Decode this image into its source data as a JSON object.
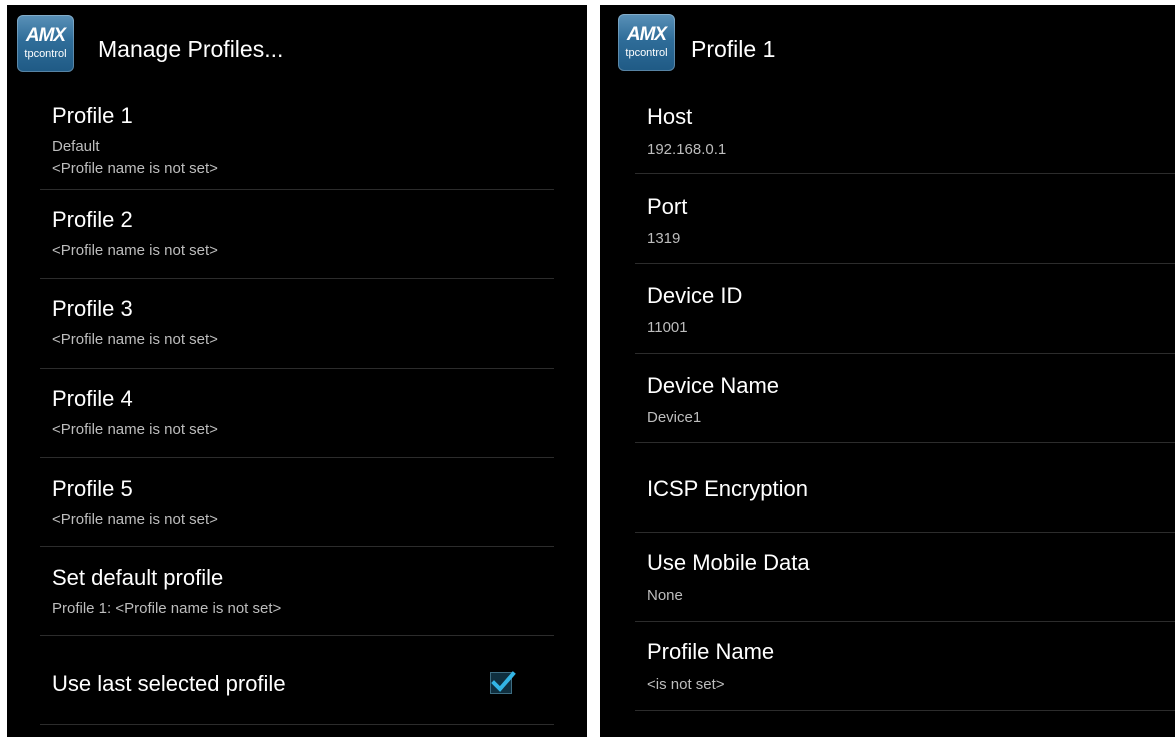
{
  "left_screen": {
    "header": {
      "app_icon": "amx-tpcontrol-icon",
      "icon_brand": "AMX",
      "icon_subtitle": "tpcontrol",
      "title": "Manage Profiles..."
    },
    "items": [
      {
        "title": "Profile 1",
        "sub1": "Default",
        "sub2": "<Profile name is not set>"
      },
      {
        "title": "Profile 2",
        "sub1": "<Profile name is not set>"
      },
      {
        "title": "Profile 3",
        "sub1": "<Profile name is not set>"
      },
      {
        "title": "Profile 4",
        "sub1": "<Profile name is not set>"
      },
      {
        "title": "Profile 5",
        "sub1": "<Profile name is not set>"
      },
      {
        "title": "Set default profile",
        "sub1": "Profile 1: <Profile name is not set>"
      },
      {
        "title": "Use last selected profile",
        "checked": true
      }
    ]
  },
  "right_screen": {
    "header": {
      "app_icon": "amx-tpcontrol-icon",
      "icon_brand": "AMX",
      "icon_subtitle": "tpcontrol",
      "title": "Profile 1"
    },
    "items": [
      {
        "title": "Host",
        "sub1": "192.168.0.1"
      },
      {
        "title": "Port",
        "sub1": "1319"
      },
      {
        "title": "Device ID",
        "sub1": "11001"
      },
      {
        "title": "Device Name",
        "sub1": "Device1"
      },
      {
        "title": "ICSP Encryption"
      },
      {
        "title": "Use Mobile Data",
        "sub1": "None"
      },
      {
        "title": "Profile Name",
        "sub1": "<is not set>"
      }
    ]
  },
  "colors": {
    "background": "#000000",
    "text": "#ffffff",
    "subtext": "#bdbdbd",
    "divider": "#2c2c2c",
    "accent": "#33b5e5"
  }
}
